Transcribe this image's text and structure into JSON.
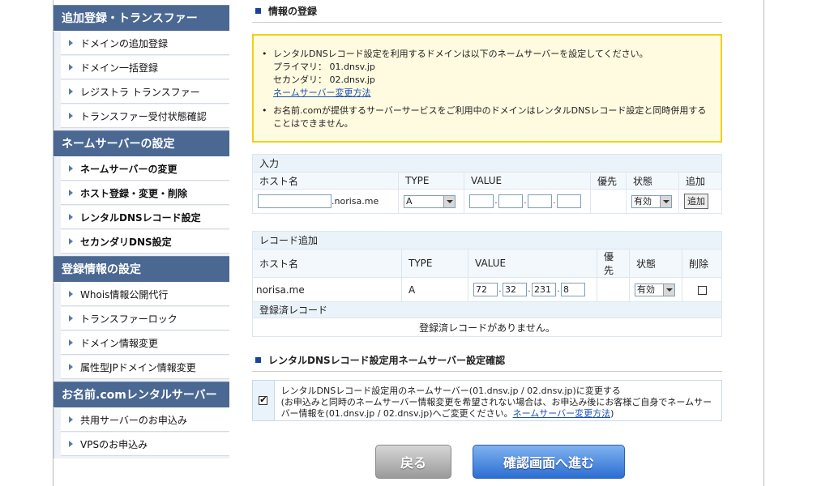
{
  "sidebar": {
    "sections": [
      {
        "title": "追加登録・トランスファー",
        "items": [
          "ドメインの追加登録",
          "ドメイン一括登録",
          "レジストラ トランスファー",
          "トランスファー受付状態確認"
        ]
      },
      {
        "title": "ネームサーバーの設定",
        "items": [
          "ネームサーバーの変更",
          "ホスト登録・変更・削除",
          "レンタルDNSレコード設定",
          "セカンダリDNS設定"
        ]
      },
      {
        "title": "登録情報の設定",
        "items": [
          "Whois情報公開代行",
          "トランスファーロック",
          "ドメイン情報変更",
          "属性型JPドメイン情報変更"
        ]
      },
      {
        "title": "お名前.comレンタルサーバー",
        "items": [
          "共用サーバーのお申込み",
          "VPSのお申込み"
        ]
      }
    ]
  },
  "main": {
    "title": "情報の登録",
    "notice": {
      "line1": "レンタルDNSレコード設定を利用するドメインは以下のネームサーバーを設定してください。",
      "primary": "プライマリ： 01.dnsv.jp",
      "secondary": "セカンダリ： 02.dnsv.jp",
      "link": "ネームサーバー変更方法",
      "line2": "お名前.comが提供するサーバーサービスをご利用中のドメインはレンタルDNSレコード設定と同時併用することはできません。"
    },
    "input_table": {
      "caption": "入力",
      "headers": [
        "ホスト名",
        "TYPE",
        "VALUE",
        "優先",
        "状態",
        "追加"
      ],
      "domain_suffix": ".norisa.me",
      "type_value": "A",
      "status_value": "有効",
      "add_label": "追加"
    },
    "record_table": {
      "caption": "レコード追加",
      "headers": [
        "ホスト名",
        "TYPE",
        "VALUE",
        "優先",
        "状態",
        "削除"
      ],
      "row": {
        "host": "norisa.me",
        "type": "A",
        "ip": [
          "72",
          "32",
          "231",
          "8"
        ],
        "status": "有効"
      },
      "registered_caption": "登録済レコード",
      "empty_message": "登録済レコードがありません。"
    },
    "confirm": {
      "title": "レンタルDNSレコード設定用ネームサーバー設定確認",
      "text1": "レンタルDNSレコード設定用のネームサーバー(01.dnsv.jp / 02.dnsv.jp)に変更する",
      "text2": "(お申込みと同時のネームサーバー情報変更を希望されない場合は、お申込み後にお客様ご自身でネームサーバー情報を(01.dnsv.jp / 02.dnsv.jp)へご変更ください。",
      "link": "ネームサーバー変更方法",
      "close": ")"
    },
    "buttons": {
      "back": "戻る",
      "next": "確認画面へ進む"
    }
  },
  "colors": {
    "sidebar_header": "#4a6892",
    "accent": "#17449b",
    "notice_border": "#f0d01a",
    "primary_button": "#2c6ed3"
  }
}
